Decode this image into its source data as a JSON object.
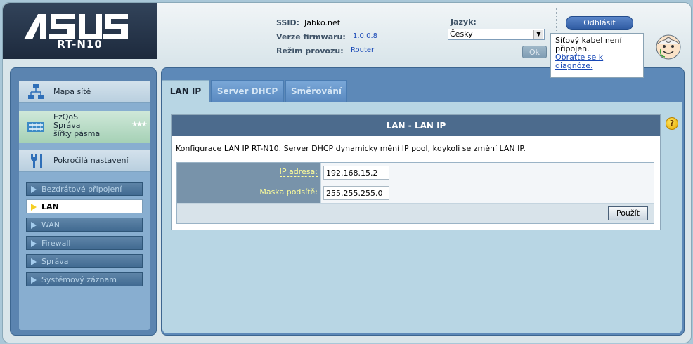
{
  "brand": {
    "logo": "ASUS",
    "model": "RT-N10"
  },
  "header": {
    "ssid_label": "SSID:",
    "ssid_value": "Jabko.net",
    "firmware_label": "Verze firmwaru:",
    "firmware_value": "1.0.0.8",
    "mode_label": "Režim provozu:",
    "mode_value": "Router",
    "language_label": "Jazyk:",
    "language_selected": "Česky",
    "ok_label": "Ok",
    "logout_label": "Odhlásit"
  },
  "tooltip": {
    "line1": "Síťový kabel není připojen.",
    "link": "Obraťte se k diagnóze."
  },
  "sidebar": {
    "items": [
      {
        "label": "Mapa sítě",
        "icon": "network-map-icon"
      },
      {
        "label_lines": [
          "EzQoS",
          "Správa",
          "šířky pásma"
        ],
        "icon": "qos-icon"
      },
      {
        "label": "Pokročilá nastavení",
        "icon": "tools-icon"
      }
    ],
    "sub_items": [
      {
        "label": "Bezdrátové připojení"
      },
      {
        "label": "LAN"
      },
      {
        "label": "WAN"
      },
      {
        "label": "Firewall"
      },
      {
        "label": "Správa"
      },
      {
        "label": "Systémový záznam"
      }
    ]
  },
  "tabs": [
    {
      "label": "LAN IP"
    },
    {
      "label": "Server DHCP"
    },
    {
      "label": "Směrování"
    }
  ],
  "panel": {
    "title": "LAN - LAN IP",
    "description": "Konfigurace LAN IP RT-N10. Server DHCP dynamicky mění IP pool, kdykoli se změní LAN IP.",
    "ip_label": "IP adresa:",
    "ip_value": "192.168.15.2",
    "mask_label": "Maska podsítě:",
    "mask_value": "255.255.255.0",
    "apply_label": "Použít"
  },
  "colors": {
    "header_dark": "#1d2a3d",
    "tab_active_bg": "#b8d6e4",
    "panel_title_bg": "#4c6b8d",
    "label_text": "#fdfd9a"
  }
}
